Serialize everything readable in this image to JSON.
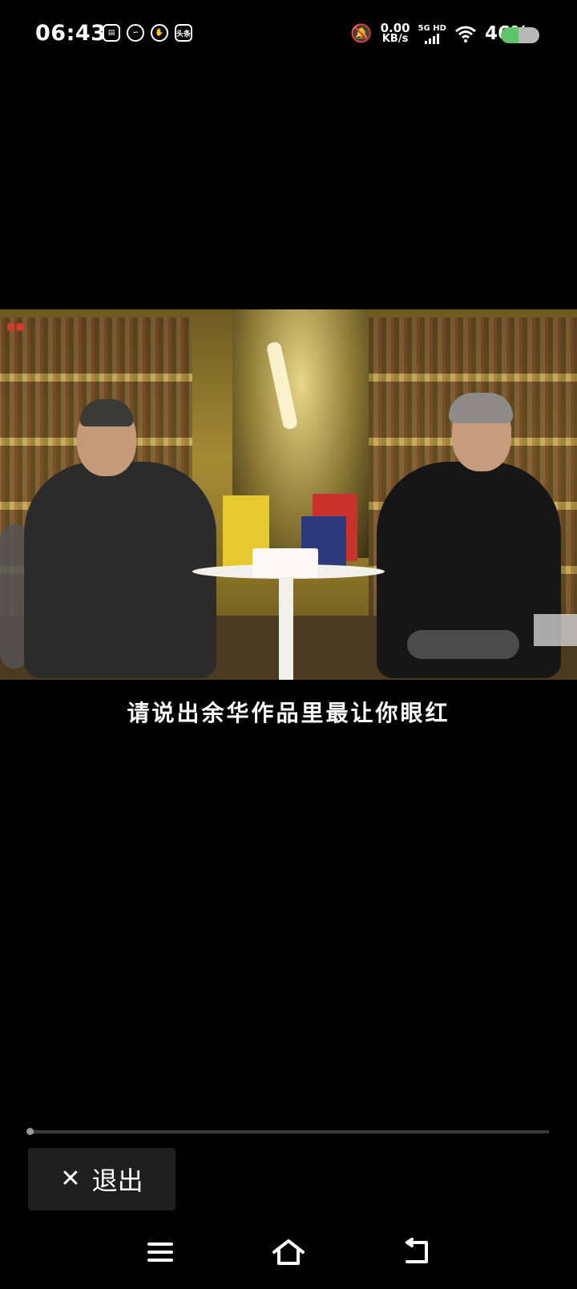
{
  "status_bar": {
    "time": "06:43",
    "notifications": [
      "sim-card-icon",
      "swirl-app-icon",
      "stop-hand-icon",
      "头条"
    ],
    "net_speed_value": "0.00",
    "net_speed_unit": "KB/s",
    "network": "5G HD",
    "battery_percent": "46%",
    "battery_level": 0.46,
    "battery_color": "#5ec46a"
  },
  "video": {
    "subtitle": "请说出余华作品里最让你眼红"
  },
  "player": {
    "progress": 0.01,
    "exit_label": "退出"
  },
  "nav": {
    "menu_icon": "menu-icon",
    "home_icon": "home-icon",
    "back_icon": "back-icon"
  }
}
